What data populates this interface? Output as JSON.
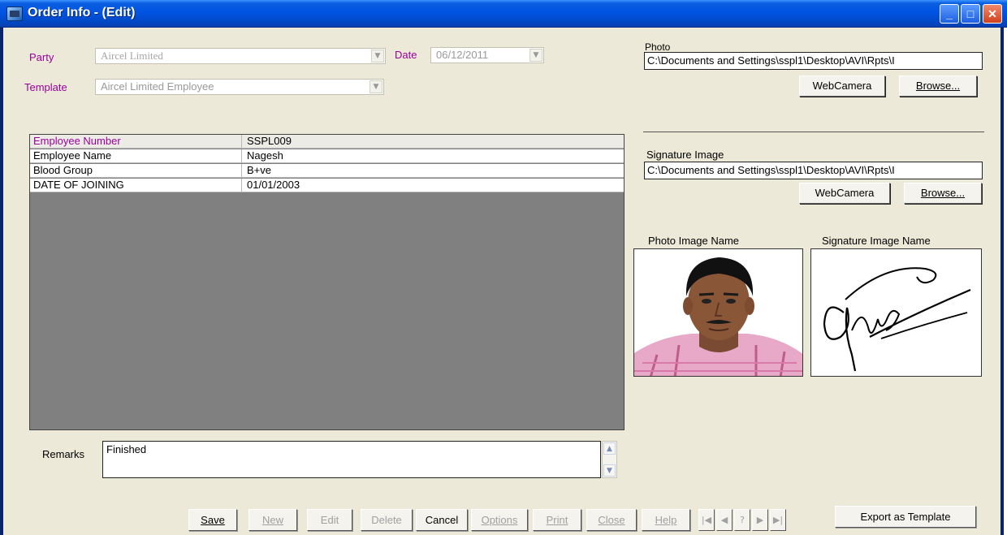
{
  "window": {
    "title": "Order Info - (Edit)",
    "minimize": "_",
    "maximize": "□",
    "close": "✕"
  },
  "form": {
    "party_label": "Party",
    "party_value": "Aircel Limited",
    "date_label": "Date",
    "date_value": "06/12/2011",
    "template_label": "Template",
    "template_value": "Aircel Limited Employee"
  },
  "photo": {
    "label": "Photo",
    "path": "C:\\Documents and Settings\\sspl1\\Desktop\\AVI\\Rpts\\I",
    "webcam_label": "WebCamera",
    "browse_label": "Browse..."
  },
  "signature": {
    "label": "Signature Image",
    "path": "C:\\Documents and Settings\\sspl1\\Desktop\\AVI\\Rpts\\I",
    "webcam_label": "WebCamera",
    "browse_label": "Browse..."
  },
  "preview": {
    "photo_caption": "Photo Image Name",
    "signature_caption": "Signature Image Name"
  },
  "grid": {
    "rows": [
      {
        "field": "Employee Number",
        "value": "SSPL009"
      },
      {
        "field": "Employee Name",
        "value": "Nagesh"
      },
      {
        "field": "Blood Group",
        "value": "B+ve"
      },
      {
        "field": "DATE OF JOINING",
        "value": "01/01/2003"
      }
    ]
  },
  "remarks": {
    "label": "Remarks",
    "value": "Finished"
  },
  "toolbar": {
    "save": "Save",
    "new": "New",
    "edit": "Edit",
    "delete": "Delete",
    "cancel": "Cancel",
    "options": "Options",
    "print": "Print",
    "close": "Close",
    "help": "Help",
    "nav_first": "|◀",
    "nav_prev": "◀",
    "nav_help": "?",
    "nav_next": "▶",
    "nav_last": "▶|",
    "export": "Export as Template"
  },
  "colors": {
    "title_bar": "#0054e3",
    "window_bg": "#ece9d8",
    "label_accent": "#9b009b",
    "grid_bg": "#808080"
  }
}
